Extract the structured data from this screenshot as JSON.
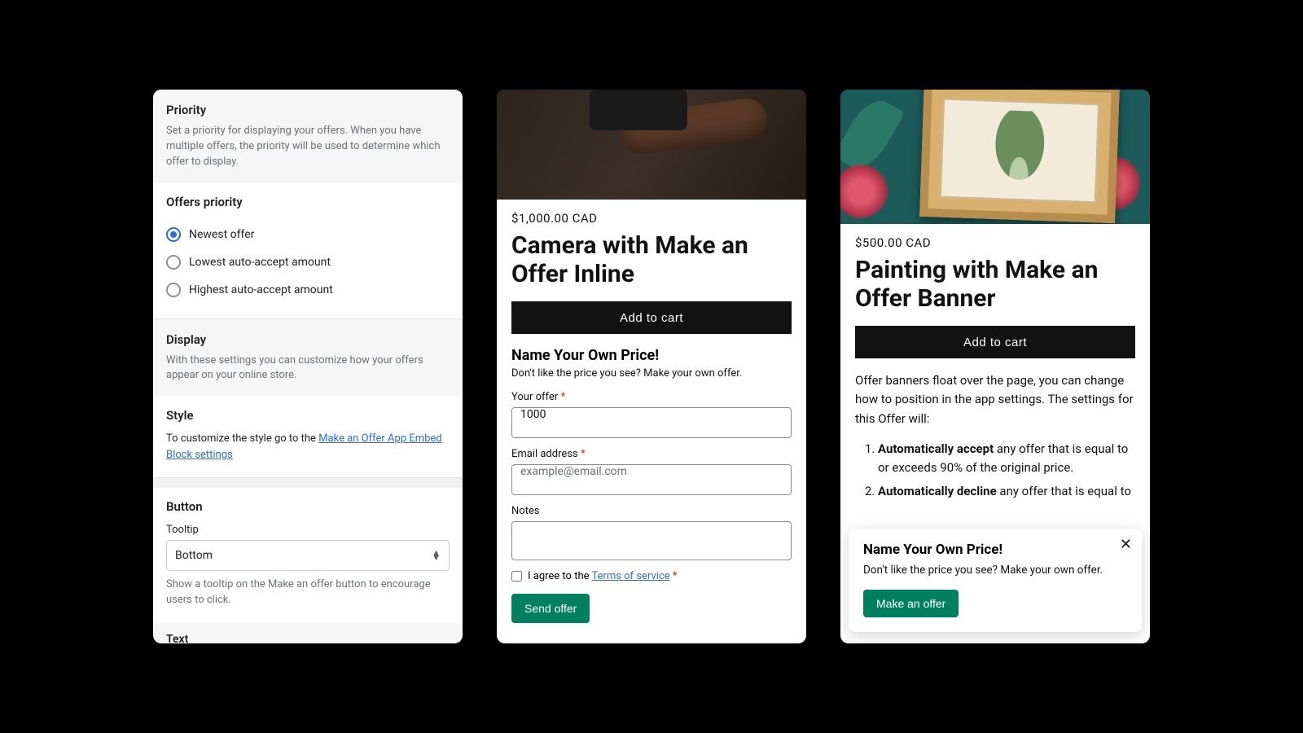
{
  "settings": {
    "priority": {
      "title": "Priority",
      "description": "Set a priority for displaying your offers. When you have multiple offers, the priority will be used to determine which offer to display.",
      "group_label": "Offers priority",
      "options": [
        {
          "label": "Newest offer",
          "checked": true
        },
        {
          "label": "Lowest auto-accept amount",
          "checked": false
        },
        {
          "label": "Highest auto-accept amount",
          "checked": false
        }
      ]
    },
    "display": {
      "title": "Display",
      "description": "With these settings you can customize how your offers appear on your online store."
    },
    "style": {
      "title": "Style",
      "lead": "To customize the style go to the ",
      "link": "Make an Offer App Embed Block settings"
    },
    "button": {
      "title": "Button",
      "tooltip_label": "Tooltip",
      "tooltip_value": "Bottom",
      "tooltip_help": "Show a tooltip on the Make an offer button to encourage users to click."
    },
    "text_title": "Text"
  },
  "product_inline": {
    "price": "$1,000.00 CAD",
    "title": "Camera with Make an Offer Inline",
    "add_to_cart": "Add to cart",
    "offer_heading": "Name Your Own Price!",
    "offer_sub": "Don't like the price you see? Make your own offer.",
    "your_offer_label": "Your offer",
    "your_offer_value": "1000",
    "email_label": "Email address",
    "email_placeholder": "example@email.com",
    "notes_label": "Notes",
    "agree_prefix": "I agree to the ",
    "terms_link": "Terms of service",
    "send_label": "Send offer"
  },
  "product_banner": {
    "price": "$500.00 CAD",
    "title": "Painting with Make an Offer Banner",
    "add_to_cart": "Add to cart",
    "description": "Offer banners float over the page, you can change how to position in the app settings. The settings for this Offer will:",
    "rule1_strong": "Automatically accept",
    "rule1_rest": " any offer that is equal to or exceeds 90% of the original price.",
    "rule2_strong": "Automatically decline",
    "rule2_rest": " any offer that is equal to",
    "float": {
      "heading": "Name Your Own Price!",
      "sub": "Don't like the price you see? Make your own offer.",
      "button": "Make an offer"
    }
  }
}
